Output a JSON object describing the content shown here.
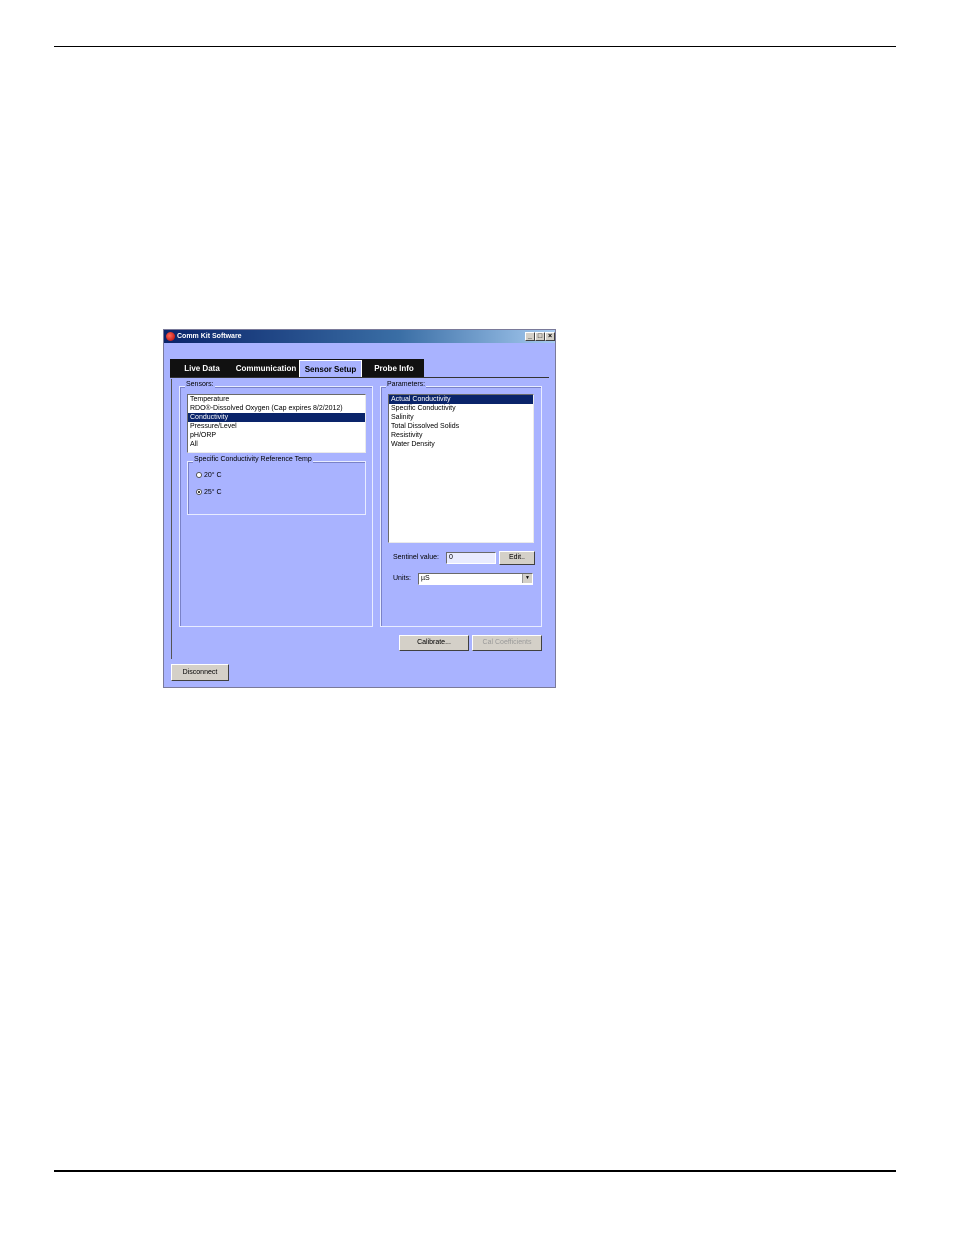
{
  "window": {
    "title": "Comm Kit Software",
    "controls": {
      "minimize": "_",
      "maximize": "□",
      "close": "×"
    }
  },
  "tabs": [
    {
      "label": "Live Data",
      "active": false
    },
    {
      "label": "Communication",
      "active": false
    },
    {
      "label": "Sensor Setup",
      "active": true
    },
    {
      "label": "Probe Info",
      "active": false
    }
  ],
  "sensors": {
    "label": "Sensors:",
    "items": [
      "Temperature",
      "RDO®-Dissolved Oxygen (Cap expires 8/2/2012)",
      "Conductivity",
      "Pressure/Level",
      "pH/ORP",
      "All"
    ],
    "selected_index": 2
  },
  "reference_temp": {
    "label": "Specific Conductivity Reference Temp",
    "options": [
      "20° C",
      "25° C"
    ],
    "selected_index": 1
  },
  "parameters": {
    "label": "Parameters:",
    "items": [
      "Actual Conductivity",
      "Specific Conductivity",
      "Salinity",
      "Total Dissolved Solids",
      "Resistivity",
      "Water Density"
    ],
    "selected_index": 0
  },
  "sentinel": {
    "label": "Sentinel value:",
    "value": "0",
    "edit_button": "Edit.."
  },
  "units": {
    "label": "Units:",
    "value": "µS"
  },
  "buttons": {
    "calibrate": "Calibrate...",
    "cal_coefficients": "Cal Coefficients",
    "disconnect": "Disconnect"
  },
  "colors": {
    "window_bg": "#a9b3ff",
    "selection": "#0a246a",
    "tab_bar": "#111111"
  }
}
